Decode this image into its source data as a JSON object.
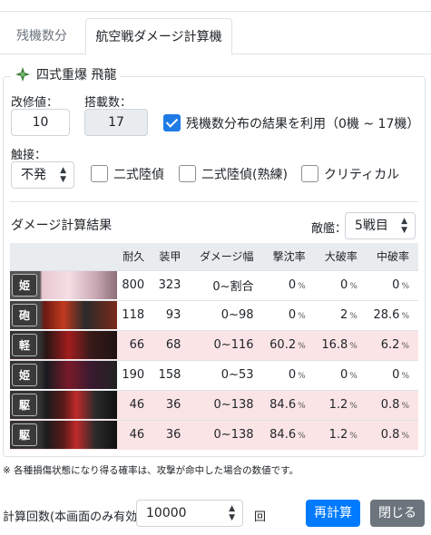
{
  "tabs": [
    "残機数分布",
    "航空戦ダメージ計算機"
  ],
  "ship": {
    "name": "四式重爆 飛龍",
    "icon": "bomber-plane-icon"
  },
  "fields": {
    "improvement_label": "改修値：",
    "improvement_value": "10",
    "slot_label": "搭載数：",
    "slot_value": "17",
    "use_distribution_label": "残機数分布の結果を利用（0機 ~ 17機）",
    "use_distribution_checked": true,
    "contact_label": "触接：",
    "contact_value": "不発",
    "opt_1": "二式陸偵",
    "opt_2": "二式陸偵(熟練)",
    "opt_3": "クリティカル"
  },
  "results": {
    "title": "ダメージ計算結果",
    "enemy_label": "敵艦：",
    "enemy_value": "5戦目",
    "headers": [
      "",
      "耐久",
      "装甲",
      "ダメージ幅",
      "撃沈率",
      "大破率",
      "中破率"
    ],
    "rows": [
      {
        "tag": "姫",
        "hp": "800",
        "armor": "323",
        "range": "0~割合",
        "sink": "0",
        "heavy": "0",
        "mid": "0",
        "highlight": false,
        "banner": "pink-hair-princess-banner"
      },
      {
        "tag": "砲",
        "hp": "118",
        "armor": "93",
        "range": "0~98",
        "sink": "0",
        "heavy": "2",
        "mid": "28.6",
        "highlight": false,
        "banner": "red-turret-installation-banner"
      },
      {
        "tag": "軽",
        "hp": "66",
        "armor": "68",
        "range": "0~116",
        "sink": "60.2",
        "heavy": "16.8",
        "mid": "6.2",
        "highlight": true,
        "banner": "light-cruiser-enemy-banner"
      },
      {
        "tag": "姫",
        "hp": "190",
        "armor": "158",
        "range": "0~53",
        "sink": "0",
        "heavy": "0",
        "mid": "0",
        "highlight": false,
        "banner": "dark-princess-banner"
      },
      {
        "tag": "駆",
        "hp": "46",
        "armor": "36",
        "range": "0~138",
        "sink": "84.6",
        "heavy": "1.2",
        "mid": "0.8",
        "highlight": true,
        "banner": "destroyer-enemy-banner"
      },
      {
        "tag": "駆",
        "hp": "46",
        "armor": "36",
        "range": "0~138",
        "sink": "84.6",
        "heavy": "1.2",
        "mid": "0.8",
        "highlight": true,
        "banner": "destroyer-enemy-banner"
      }
    ],
    "pct_unit": "%"
  },
  "note": "※ 各種損傷状態になり得る確率は、攻撃が命中した場合の数値です。",
  "footer": {
    "count_label": "計算回数(本画面のみ有効)",
    "count_value": "10000",
    "count_unit": "回",
    "recalc_label": "再計算",
    "close_label": "閉じる"
  },
  "colors": {
    "primary": "#007bff",
    "secondary": "#6c757d",
    "check": "#1e7be6",
    "row_highlight": "#fbe4e6"
  }
}
